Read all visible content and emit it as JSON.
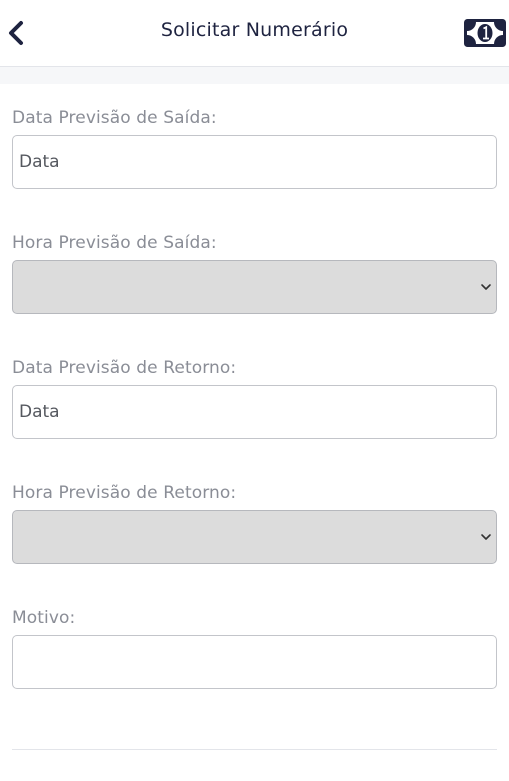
{
  "header": {
    "title": "Solicitar Numerário",
    "back_icon": "chevron-left-icon",
    "action_icon": "banknote-icon",
    "accent_color": "#1e2340"
  },
  "form": {
    "data_saida": {
      "label": "Data Previsão de Saída:",
      "placeholder": "Data",
      "value": ""
    },
    "hora_saida": {
      "label": "Hora Previsão de Saída:",
      "value": ""
    },
    "data_retorno": {
      "label": "Data Previsão de Retorno:",
      "placeholder": "Data",
      "value": ""
    },
    "hora_retorno": {
      "label": "Hora Previsão de Retorno:",
      "value": ""
    },
    "motivo": {
      "label": "Motivo:",
      "value": ""
    }
  }
}
